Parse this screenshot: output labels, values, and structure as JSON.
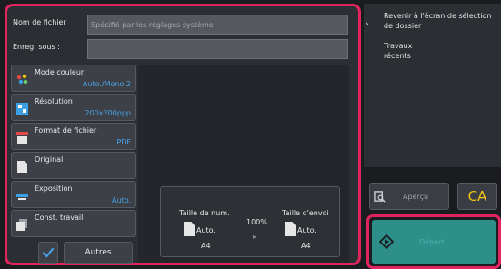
{
  "fields": {
    "filename_label": "Nom de fichier",
    "filename_placeholder": "Spécifié par les réglages système",
    "save_as_label": "Enreg. sous :",
    "save_as_value": ""
  },
  "menu": [
    {
      "label": "Mode couleur",
      "value": "Auto./Mono 2",
      "icon": "color-mode-icon"
    },
    {
      "label": "Résolution",
      "value": "200x200ppp",
      "icon": "resolution-icon"
    },
    {
      "label": "Format de fichier",
      "value": "PDF",
      "icon": "file-format-icon"
    },
    {
      "label": "Original",
      "value": "",
      "icon": "original-icon"
    },
    {
      "label": "Exposition",
      "value": "Auto.",
      "icon": "exposure-icon"
    },
    {
      "label": "Const. travail",
      "value": "",
      "icon": "job-build-icon"
    }
  ],
  "summary": {
    "scan_size_label": "Taille de num.",
    "scan_size_mode": "Auto.",
    "scan_size_paper": "A4",
    "ratio": "100%",
    "send_size_label": "Taille d'envoi",
    "send_size_mode": "Auto.",
    "send_size_paper": "A4"
  },
  "right": {
    "back_label": "Revenir à l'écran de sélection de dossier",
    "recent_label": "Travaux récents",
    "preview_label": "Aperçu",
    "ca_label": "CA",
    "start_label": "Départ"
  },
  "bottom": {
    "others_label": "Autres"
  },
  "colors": {
    "highlight": "#e0245e",
    "value_blue": "#4aa3e8",
    "ca_yellow": "#f1c40f",
    "start_teal": "#2e8f8a"
  }
}
